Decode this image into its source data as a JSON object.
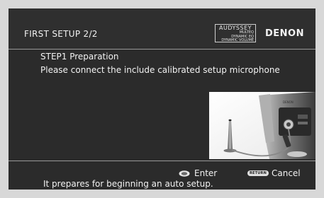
{
  "header": {
    "title": "FIRST SETUP 2/2",
    "audyssey_brand": "AUDYSSEY",
    "audyssey_lines": [
      "MULTEQ",
      "DYNAMIC EQ",
      "DYNAMIC VOLUME"
    ],
    "denon_logo": "DENON"
  },
  "content": {
    "step_title": "STEP1 Preparation",
    "step_text": "Please connect the include calibrated setup microphone"
  },
  "photo": {
    "device_label": "DENON"
  },
  "footer": {
    "enter_label": "Enter",
    "return_badge": "RETURN",
    "cancel_label": "Cancel",
    "help_text": "It prepares for beginning an auto setup."
  },
  "icons": {
    "enter": "enter-button-icon",
    "return": "return-button-icon"
  },
  "colors": {
    "screen_bg": "#2b2b2b",
    "frame_bg": "#d8d8d8",
    "text": "#f2f2f2"
  }
}
